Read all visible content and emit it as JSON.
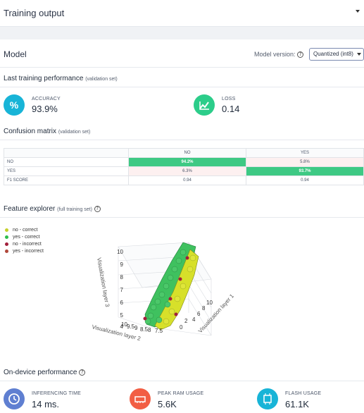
{
  "header": {
    "title": "Training output"
  },
  "model": {
    "title": "Model",
    "version_label": "Model version:",
    "version_selected": "Quantized (int8)"
  },
  "last_training": {
    "title": "Last training performance",
    "subtitle": "(validation set)",
    "accuracy": {
      "label": "ACCURACY",
      "value": "93.9%",
      "icon": "percent-icon",
      "color": "#18b4d7"
    },
    "loss": {
      "label": "LOSS",
      "value": "0.14",
      "icon": "chart-line-icon",
      "color": "#2ccd8a"
    }
  },
  "confusion": {
    "title": "Confusion matrix",
    "subtitle": "(validation set)",
    "columns": [
      "NO",
      "YES"
    ],
    "rows": [
      {
        "label": "NO",
        "cells": [
          "94.2%",
          "5.8%"
        ]
      },
      {
        "label": "YES",
        "cells": [
          "6.3%",
          "93.7%"
        ]
      },
      {
        "label": "F1 SCORE",
        "cells": [
          "0.94",
          "0.94"
        ]
      }
    ]
  },
  "feature_explorer": {
    "title": "Feature explorer",
    "subtitle": "(full training set)",
    "legend": [
      {
        "label": "no - correct",
        "color": "#c6d02b"
      },
      {
        "label": "yes - correct",
        "color": "#2dbd4b"
      },
      {
        "label": "no - incorrect",
        "color": "#a11f3b"
      },
      {
        "label": "yes - incorrect",
        "color": "#b0473a"
      }
    ],
    "axes": {
      "layer1": "Visualization layer 1",
      "layer2": "Visualization layer 2",
      "layer3": "Visualization layer 3"
    },
    "z_ticks": [
      "10",
      "9",
      "8",
      "7",
      "6",
      "5",
      "4"
    ],
    "x_ticks": [
      "10",
      "8",
      "6",
      "4",
      "2",
      "0"
    ],
    "y_ticks": [
      "10",
      "9.5",
      "9",
      "8.5",
      "8",
      "7.5"
    ]
  },
  "on_device": {
    "title": "On-device performance",
    "inferencing": {
      "label": "INFERENCING TIME",
      "value": "14 ms.",
      "icon": "clock-icon",
      "color": "#5f7fd1"
    },
    "ram": {
      "label": "PEAK RAM USAGE",
      "value": "5.6K",
      "icon": "memory-icon",
      "color": "#f25e44"
    },
    "flash": {
      "label": "FLASH USAGE",
      "value": "61.1K",
      "icon": "chip-icon",
      "color": "#18b4d7"
    }
  }
}
